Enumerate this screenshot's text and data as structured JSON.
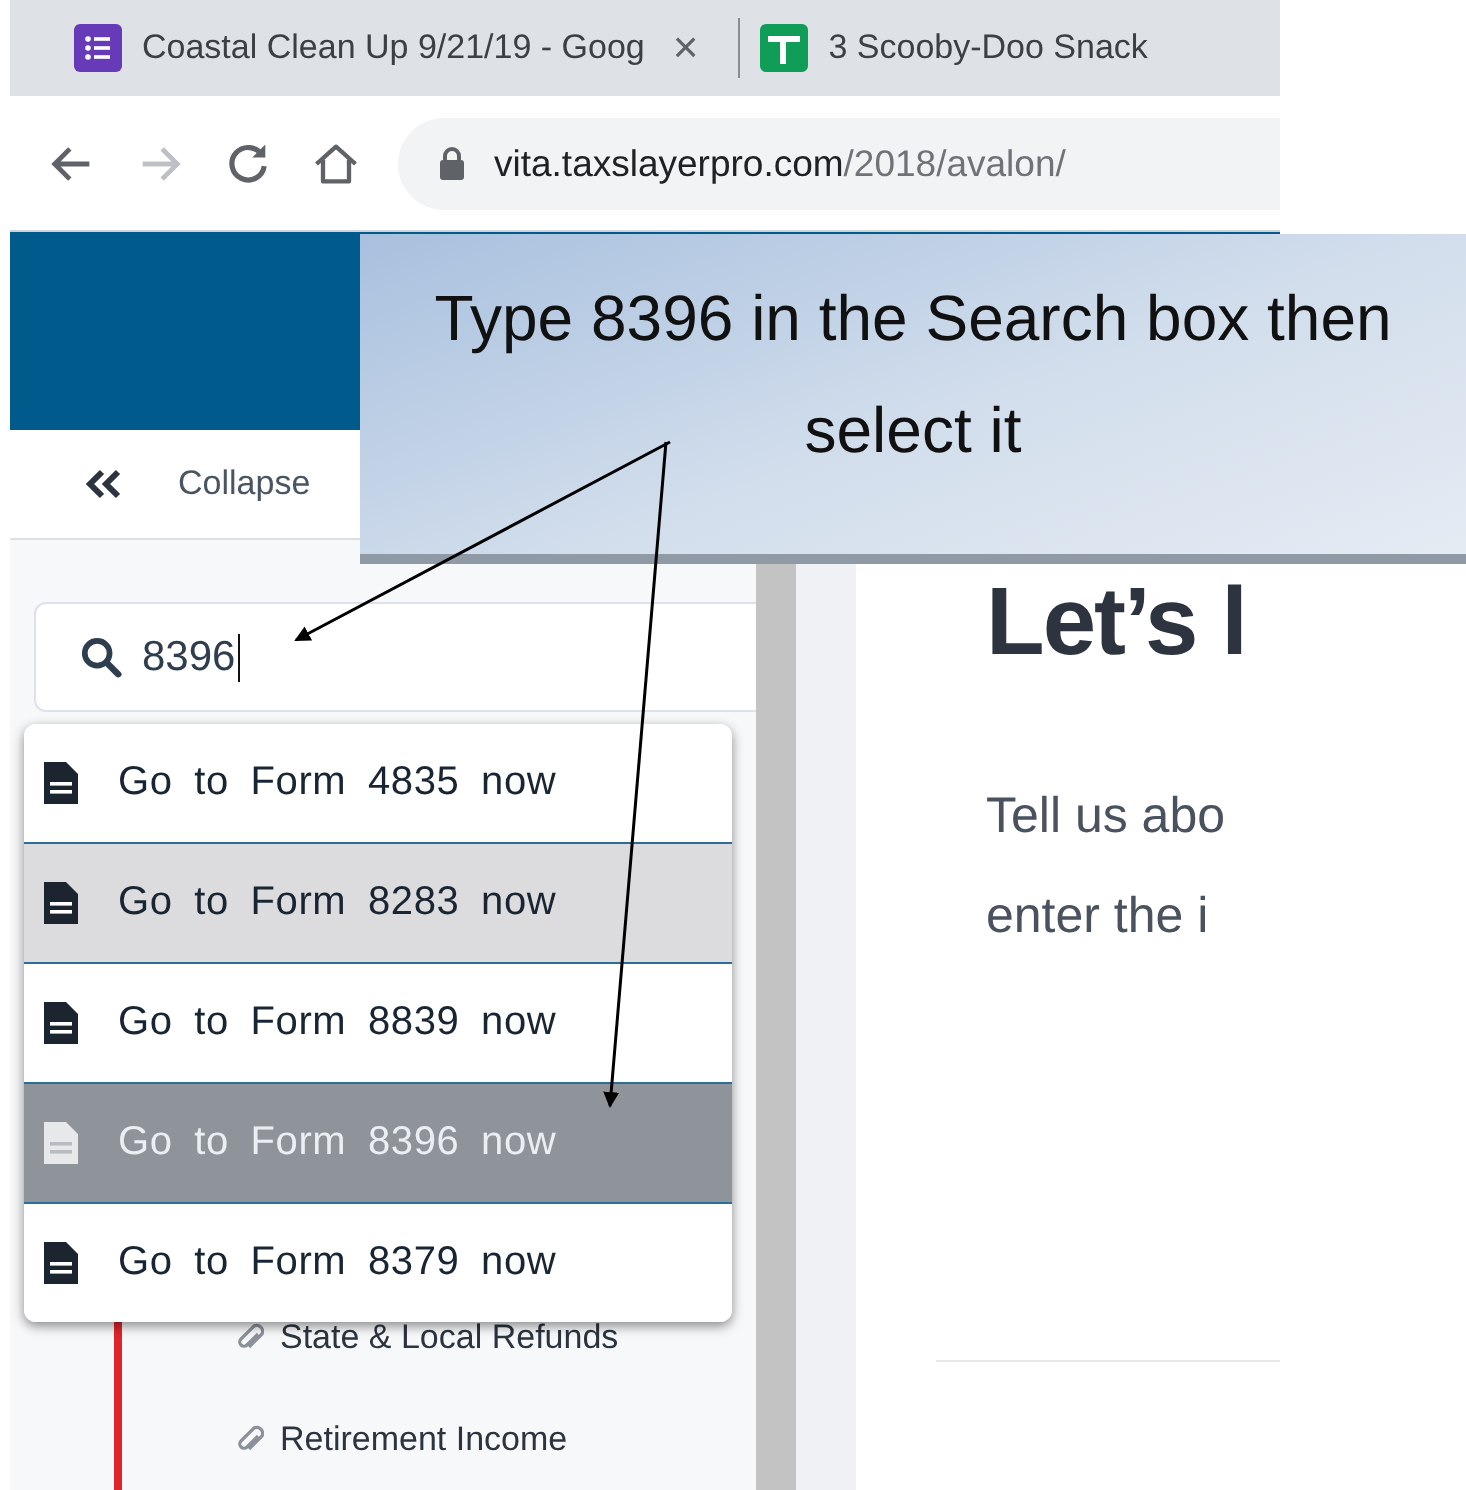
{
  "browser": {
    "tabs": [
      {
        "title": "Coastal Clean Up 9/21/19 - Goog",
        "kind": "form",
        "close": "×"
      },
      {
        "title": "3 Scooby-Doo Snack",
        "kind": "sheet"
      }
    ],
    "address": {
      "host": "vita.taxslayerpro.com",
      "path": "/2018/avalon/"
    },
    "forward_disabled": true
  },
  "sidebar": {
    "collapse_label": "Collapse",
    "search": {
      "value": "8396"
    },
    "suggestions": [
      {
        "label": "Go to Form 4835 now",
        "selected": false,
        "hovered": false
      },
      {
        "label": "Go to Form 8283 now",
        "selected": false,
        "hovered": true
      },
      {
        "label": "Go to Form 8839 now",
        "selected": false,
        "hovered": false
      },
      {
        "label": "Go to Form 8396 now",
        "selected": true,
        "hovered": false
      },
      {
        "label": "Go to Form 8379 now",
        "selected": false,
        "hovered": false
      }
    ],
    "tree_items": [
      {
        "label": "State & Local Refunds"
      },
      {
        "label": "Retirement Income"
      }
    ]
  },
  "main": {
    "heading": "Let’s l",
    "paragraph_lines": [
      "Tell us abo",
      "enter the i"
    ]
  },
  "callout": {
    "text": "Type 8396 in the Search box then select it"
  }
}
